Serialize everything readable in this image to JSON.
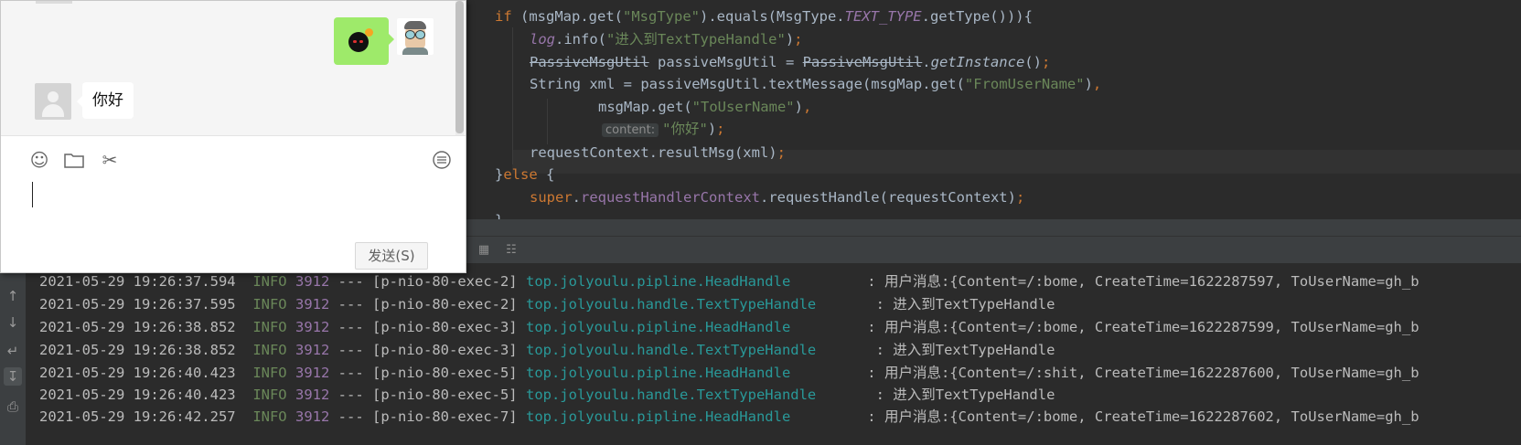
{
  "editor": {
    "lines": {
      "l1_kw": "if",
      "l1_a": " (msgMap.get(",
      "l1_str": "\"MsgType\"",
      "l1_b": ").equals(MsgType.",
      "l1_const": "TEXT_TYPE",
      "l1_c": ".getType())){",
      "l2_log": "log",
      "l2_a": ".info(",
      "l2_str": "\"进入到TextTypeHandle\"",
      "l2_b": ")",
      "l2_semi": ";",
      "l3_type": "PassiveMsgUtil",
      "l3_a": " passiveMsgUtil = ",
      "l3_type2": "PassiveMsgUtil",
      "l3_b": ".",
      "l3_method": "getInstance",
      "l3_c": "()",
      "l3_semi": ";",
      "l4_a": "String xml = passiveMsgUtil.textMessage(msgMap.get(",
      "l4_str": "\"FromUserName\"",
      "l4_b": ")",
      "l4_comma": ",",
      "l5_a": "msgMap.get(",
      "l5_str": "\"ToUserName\"",
      "l5_b": ")",
      "l5_comma": ",",
      "l6_hint": "content:",
      "l6_str": "\"你好\"",
      "l6_b": ")",
      "l6_semi": ";",
      "l7_a": "requestContext.resultMsg(xml)",
      "l7_semi": ";",
      "l8_a": "}",
      "l8_kw": "else",
      "l8_b": " {",
      "l9_kw": "super",
      "l9_dot": ".",
      "l9_fld": "requestHandlerContext",
      "l9_a": ".requestHandle(requestContext)",
      "l9_semi": ";",
      "l10_a": "}"
    }
  },
  "chat": {
    "received_message": "你好",
    "send_button": "发送(S)",
    "toolbar_icons": [
      "emoji-icon",
      "folder-icon",
      "scissors-icon",
      "chat-history-icon"
    ]
  },
  "console": {
    "rows": [
      {
        "time": "2021-05-29 19:26:37.594",
        "level": "INFO",
        "pid": "3912",
        "sep": "---",
        "thread": "[p-nio-80-exec-2]",
        "logger": "top.jolyoulu.pipline.HeadHandle",
        "msg": ": 用户消息:{Content=/:bome, CreateTime=1622287597, ToUserName=gh_b"
      },
      {
        "time": "2021-05-29 19:26:37.595",
        "level": "INFO",
        "pid": "3912",
        "sep": "---",
        "thread": "[p-nio-80-exec-2]",
        "logger": "top.jolyoulu.handle.TextTypeHandle",
        "msg": ": 进入到TextTypeHandle"
      },
      {
        "time": "2021-05-29 19:26:38.852",
        "level": "INFO",
        "pid": "3912",
        "sep": "---",
        "thread": "[p-nio-80-exec-3]",
        "logger": "top.jolyoulu.pipline.HeadHandle",
        "msg": ": 用户消息:{Content=/:bome, CreateTime=1622287599, ToUserName=gh_b"
      },
      {
        "time": "2021-05-29 19:26:38.852",
        "level": "INFO",
        "pid": "3912",
        "sep": "---",
        "thread": "[p-nio-80-exec-3]",
        "logger": "top.jolyoulu.handle.TextTypeHandle",
        "msg": ": 进入到TextTypeHandle"
      },
      {
        "time": "2021-05-29 19:26:40.423",
        "level": "INFO",
        "pid": "3912",
        "sep": "---",
        "thread": "[p-nio-80-exec-5]",
        "logger": "top.jolyoulu.pipline.HeadHandle",
        "msg": ": 用户消息:{Content=/:shit, CreateTime=1622287600, ToUserName=gh_b"
      },
      {
        "time": "2021-05-29 19:26:40.423",
        "level": "INFO",
        "pid": "3912",
        "sep": "---",
        "thread": "[p-nio-80-exec-5]",
        "logger": "top.jolyoulu.handle.TextTypeHandle",
        "msg": ": 进入到TextTypeHandle"
      },
      {
        "time": "2021-05-29 19:26:42.257",
        "level": "INFO",
        "pid": "3912",
        "sep": "---",
        "thread": "[p-nio-80-exec-7]",
        "logger": "top.jolyoulu.pipline.HeadHandle",
        "msg": ": 用户消息:{Content=/:bome, CreateTime=1622287602, ToUserName=gh_b"
      }
    ]
  },
  "colors": {
    "editor_bg": "#2b2b2b",
    "keyword": "#cc7832",
    "string": "#6a8759",
    "field": "#9876aa",
    "logger": "#299999",
    "chat_sent_bubble": "#9eea6a"
  }
}
